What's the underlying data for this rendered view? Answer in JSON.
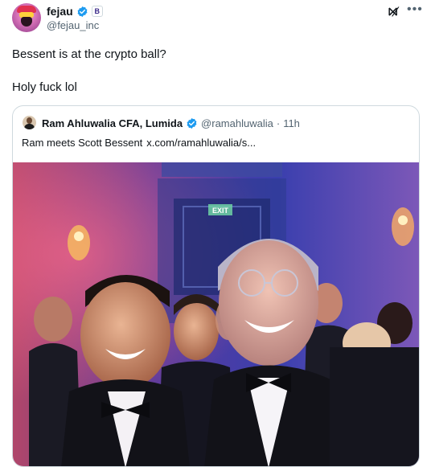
{
  "author": {
    "display_name": "fejau",
    "handle": "@fejau_inc",
    "affiliate_badge": "B"
  },
  "toolbar": {
    "grok_label": "⨝̸",
    "more_label": "•••"
  },
  "tweet": {
    "line1": "Bessent is at the crypto ball?",
    "line2": "Holy fuck lol"
  },
  "quote": {
    "display_name": "Ram Ahluwalia CFA, Lumida",
    "handle": "@ramahluwalia",
    "separator": "·",
    "time": "11h",
    "text": "Ram meets Scott Bessent",
    "link": "x.com/ramahluwalia/s..."
  },
  "photo": {
    "sign_text": "EXIT"
  },
  "colors": {
    "verified_blue": "#1d9bf0",
    "secondary_text": "#536471",
    "border": "#cfd9de"
  }
}
